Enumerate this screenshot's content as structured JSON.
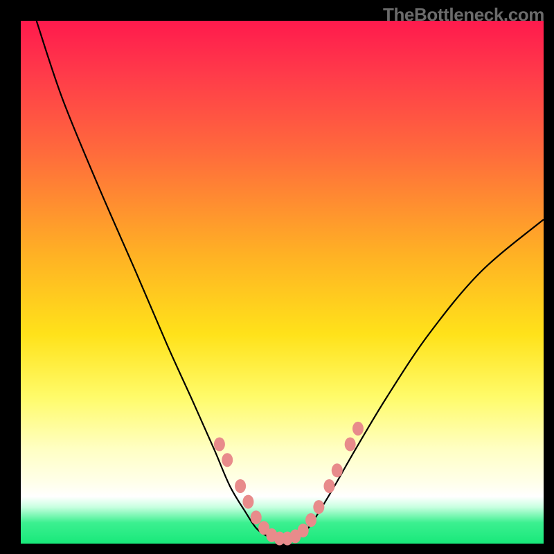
{
  "watermark": "TheBottleneck.com",
  "chart_data": {
    "type": "line",
    "title": "",
    "xlabel": "",
    "ylabel": "",
    "xlim": [
      0,
      100
    ],
    "ylim": [
      0,
      100
    ],
    "grid": false,
    "series": [
      {
        "name": "bottleneck-curve",
        "x": [
          3,
          8,
          15,
          22,
          28,
          33,
          37,
          40,
          43,
          45,
          47,
          49,
          51,
          53,
          55,
          57,
          60,
          64,
          70,
          78,
          88,
          100
        ],
        "y": [
          100,
          85,
          68,
          52,
          38,
          27,
          18,
          11,
          6,
          3,
          1.5,
          1,
          1,
          1.5,
          3,
          6,
          11,
          18,
          28,
          40,
          52,
          62
        ],
        "color": "#000000"
      }
    ],
    "markers": {
      "name": "highlight-dots",
      "color": "#e88b8b",
      "points": [
        {
          "x": 38,
          "y": 19
        },
        {
          "x": 39.5,
          "y": 16
        },
        {
          "x": 42,
          "y": 11
        },
        {
          "x": 43.5,
          "y": 8
        },
        {
          "x": 45,
          "y": 5
        },
        {
          "x": 46.5,
          "y": 3
        },
        {
          "x": 48,
          "y": 1.6
        },
        {
          "x": 49.5,
          "y": 1
        },
        {
          "x": 51,
          "y": 1
        },
        {
          "x": 52.5,
          "y": 1.4
        },
        {
          "x": 54,
          "y": 2.5
        },
        {
          "x": 55.5,
          "y": 4.5
        },
        {
          "x": 57,
          "y": 7
        },
        {
          "x": 59,
          "y": 11
        },
        {
          "x": 60.5,
          "y": 14
        },
        {
          "x": 63,
          "y": 19
        },
        {
          "x": 64.5,
          "y": 22
        }
      ]
    }
  }
}
